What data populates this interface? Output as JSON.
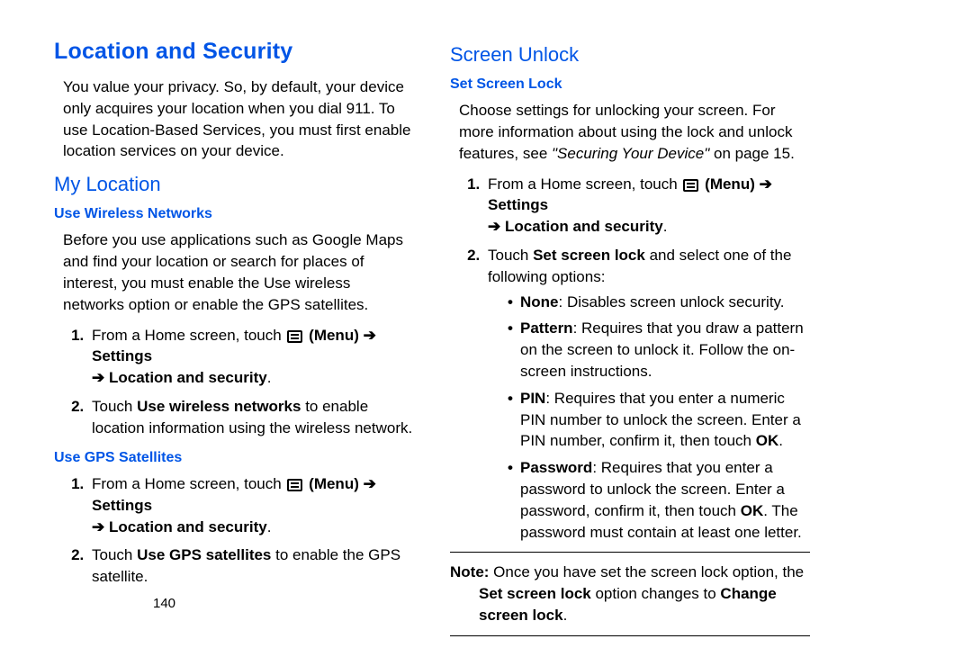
{
  "title": "Location and Security",
  "intro": "You value your privacy. So, by default, your device only acquires your location when you dial 911. To use Location-Based Services, you must first enable location services on your device.",
  "myLocation": {
    "heading": "My Location",
    "useWireless": {
      "heading": "Use Wireless Networks",
      "intro": "Before you use applications such as Google Maps and find your location or search for places of interest, you must enable the Use wireless networks option or enable the GPS satellites.",
      "step1_pre": "From a Home screen, touch ",
      "menu_label": "(Menu)",
      "arrow": "➔",
      "settings": "Settings",
      "loc_sec": "Location and security",
      "step2_pre": "Touch ",
      "step2_bold": "Use wireless networks",
      "step2_post": " to enable location information using the wireless network."
    },
    "useGps": {
      "heading": "Use GPS Satellites",
      "step2_pre": "Touch ",
      "step2_bold": "Use GPS satellites",
      "step2_post": " to enable the GPS satellite."
    }
  },
  "screenUnlock": {
    "heading": "Screen Unlock",
    "setLock": {
      "heading": "Set Screen Lock",
      "intro_pre": "Choose settings for unlocking your screen. For more information about using the lock and unlock features, see ",
      "intro_italic": "\"Securing Your Device\"",
      "intro_post": " on page 15.",
      "step2_pre": "Touch ",
      "step2_bold": "Set screen lock",
      "step2_post": " and select one of the following options:",
      "opt_none_b": "None",
      "opt_none": ": Disables screen unlock security.",
      "opt_pattern_b": "Pattern",
      "opt_pattern": ": Requires that you draw a pattern on the screen to unlock it. Follow the on-screen instructions.",
      "opt_pin_b": "PIN",
      "opt_pin": ": Requires that you enter a numeric PIN number to unlock the screen. Enter a PIN number, confirm it, then touch ",
      "ok": "OK",
      "opt_pw_b": "Password",
      "opt_pw": ": Requires that you enter a password to unlock the screen. Enter a password, confirm it, then touch ",
      "opt_pw_post": ". The password must contain at least one letter.",
      "note_b": "Note:",
      "note_pre": " Once you have set the screen lock option, the ",
      "note_bold1": "Set screen lock",
      "note_mid": " option changes to ",
      "note_bold2": "Change screen lock",
      "note_end": "."
    }
  },
  "pageNumber": "140"
}
